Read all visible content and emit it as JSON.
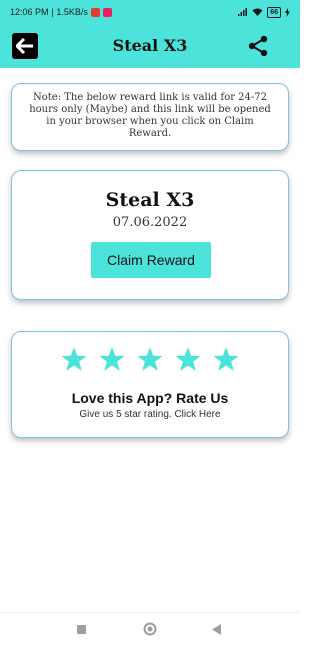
{
  "status_bar": {
    "time": "12:06 PM",
    "speed": "| 1.5KB/s",
    "battery": "66"
  },
  "app_bar": {
    "title": "Steal X3",
    "back_icon": "arrow-left-icon",
    "share_icon": "share-icon"
  },
  "note": {
    "text": "Note: The below reward link is valid for 24-72 hours only (Maybe) and this link will be opened in your browser when you click on Claim Reward."
  },
  "reward": {
    "title": "Steal X3",
    "date": "07.06.2022",
    "button_label": "Claim Reward"
  },
  "rating": {
    "stars": 5,
    "title": "Love this App? Rate Us",
    "subtitle": "Give us 5 star rating. Click Here"
  },
  "colors": {
    "accent": "#4be3da",
    "card_border": "#7cc3e8",
    "star": "#4be3da"
  },
  "nav_bar": {
    "icons": [
      "recent-apps-icon",
      "home-icon",
      "back-icon"
    ]
  }
}
